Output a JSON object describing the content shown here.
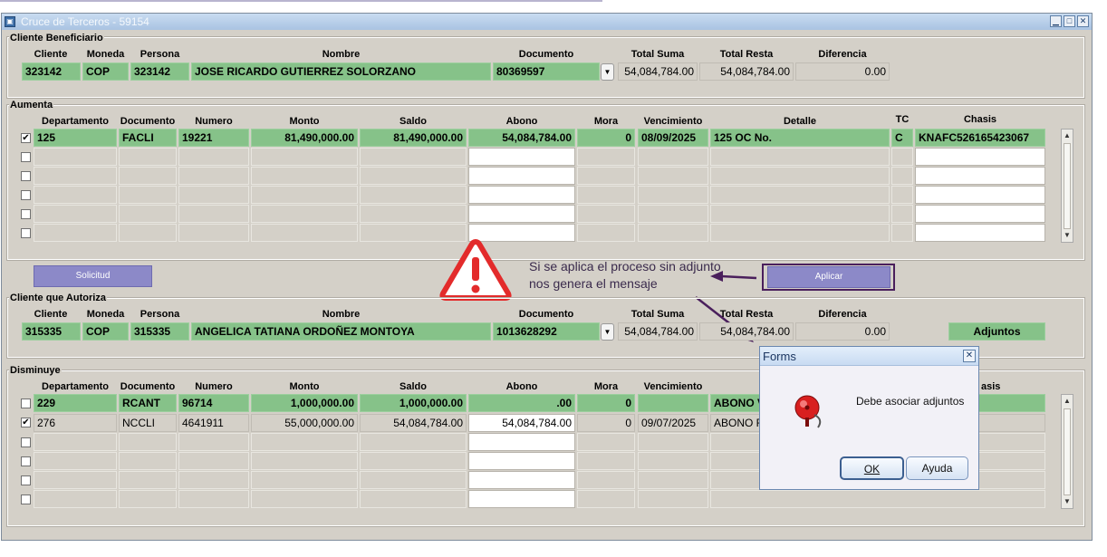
{
  "window": {
    "title": "Cruce de Terceros - 59154"
  },
  "headers": {
    "cliente": "Cliente",
    "moneda": "Moneda",
    "persona": "Persona",
    "nombre": "Nombre",
    "documento": "Documento",
    "total_suma": "Total Suma",
    "total_resta": "Total Resta",
    "diferencia": "Diferencia",
    "departamento": "Departamento",
    "numero": "Numero",
    "monto": "Monto",
    "saldo": "Saldo",
    "abono": "Abono",
    "mora": "Mora",
    "vencimiento": "Vencimiento",
    "detalle": "Detalle",
    "tc": "TC",
    "chasis": "Chasis"
  },
  "beneficiario": {
    "section": "Cliente Beneficiario",
    "cliente": "323142",
    "moneda": "COP",
    "persona": "323142",
    "nombre": "JOSE RICARDO GUTIERREZ SOLORZANO",
    "documento": "80369597",
    "total_suma": "54,084,784.00",
    "total_resta": "54,084,784.00",
    "diferencia": "0.00"
  },
  "aumenta": {
    "section": "Aumenta",
    "row1": {
      "departamento": "125",
      "documento": "FACLI",
      "numero": "19221",
      "monto": "81,490,000.00",
      "saldo": "81,490,000.00",
      "abono": "54,084,784.00",
      "mora": "0",
      "vencimiento": "08/09/2025",
      "detalle": "125 OC No.",
      "tc": "C",
      "chasis": "KNAFC526165423067",
      "checked": "✔"
    }
  },
  "buttons": {
    "solicitud": "Solicitud",
    "aplicar": "Aplicar",
    "adjuntos": "Adjuntos"
  },
  "annotation": {
    "text": "Si se aplica el proceso sin adjunto nos genera el mensaje"
  },
  "autoriza": {
    "section": "Cliente que Autoriza",
    "cliente": "315335",
    "moneda": "COP",
    "persona": "315335",
    "nombre": "ANGELICA TATIANA ORDOÑEZ MONTOYA",
    "documento": "1013628292",
    "total_suma": "54,084,784.00",
    "total_resta": "54,084,784.00",
    "diferencia": "0.00"
  },
  "disminuye": {
    "section": "Disminuye",
    "chasis_hdr": "asis",
    "row1": {
      "departamento": "229",
      "documento": "RCANT",
      "numero": "96714",
      "monto": "1,000,000.00",
      "saldo": "1,000,000.00",
      "abono": ".00",
      "mora": "0",
      "vencimiento": "",
      "detalle": "ABONO V"
    },
    "row2": {
      "departamento": "276",
      "documento": "NCCLI",
      "numero": "4641911",
      "monto": "55,000,000.00",
      "saldo": "54,084,784.00",
      "abono": "54,084,784.00",
      "mora": "0",
      "vencimiento": "09/07/2025",
      "detalle": "ABONO R",
      "checked": "✔"
    }
  },
  "dialog": {
    "title": "Forms",
    "message": "Debe asociar adjuntos",
    "ok": "OK",
    "help": "Ayuda"
  },
  "colors": {
    "field_green": "#86c289",
    "panel_gray": "#d4d0c8",
    "button_purple": "#8c89c8",
    "alert_red": "#e32b2b"
  }
}
